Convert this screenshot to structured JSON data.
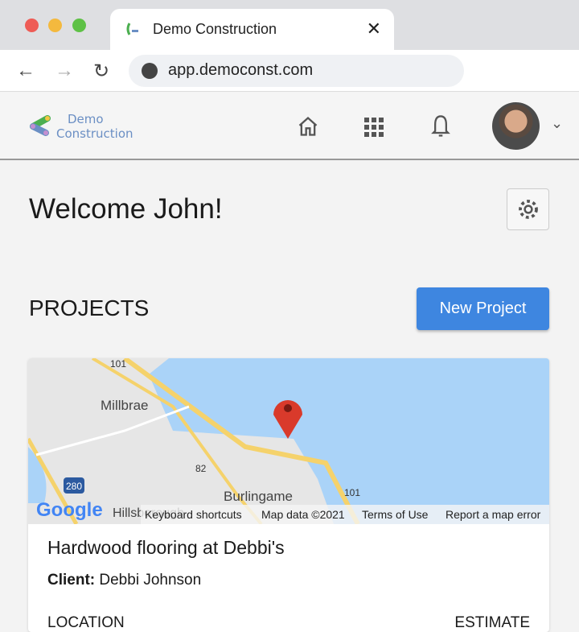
{
  "browser": {
    "tab_title": "Demo Construction",
    "url": "app.democonst.com"
  },
  "header": {
    "logo_line1": "Demo",
    "logo_line2": "Construction",
    "icons": [
      "home-icon",
      "apps-grid-icon",
      "bell-icon",
      "avatar",
      "chevron-down-icon"
    ]
  },
  "main": {
    "welcome": "Welcome John!",
    "projects_heading": "PROJECTS",
    "new_project_label": "New Project"
  },
  "project": {
    "map": {
      "labels": [
        "Millbrae",
        "Burlingame",
        "Hillsborough"
      ],
      "shields": [
        "101",
        "82",
        "280",
        "101"
      ],
      "attribution": {
        "keyboard": "Keyboard shortcuts",
        "data": "Map data ©2021",
        "terms": "Terms of Use",
        "report": "Report a map error"
      }
    },
    "title": "Hardwood flooring at Debbi's",
    "client_label": "Client:",
    "client_name": "Debbi Johnson",
    "col_location": "LOCATION",
    "col_estimate": "ESTIMATE"
  },
  "colors": {
    "accent": "#3e86e0",
    "water": "#aad3f8",
    "pin": "#d93a2b"
  }
}
